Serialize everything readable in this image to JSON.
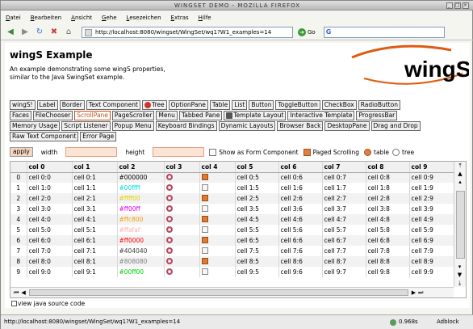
{
  "window": {
    "title": "WINGSET DEMO - MOZILLA FIREFOX"
  },
  "menu": [
    "Datei",
    "Bearbeiten",
    "Ansicht",
    "Gehe",
    "Lesezeichen",
    "Extras",
    "Hilfe"
  ],
  "nav": {
    "url": "http://localhost:8080/wingset/WingSet/wq1?W1_examples=14",
    "go_label": "Go"
  },
  "page": {
    "title": "wingS Example",
    "description": "An example demonstrating some wingS properties, similar to the Java SwingSet example.",
    "logo_text": "wingS"
  },
  "tabs": [
    [
      {
        "label": "wingS!"
      },
      {
        "label": "Label"
      },
      {
        "label": "Border"
      },
      {
        "label": "Text Component"
      },
      {
        "label": "Tree",
        "icon": "tree-icon"
      },
      {
        "label": "OptionPane"
      },
      {
        "label": "Table"
      },
      {
        "label": "List"
      },
      {
        "label": "Button"
      },
      {
        "label": "ToggleButton"
      },
      {
        "label": "CheckBox"
      },
      {
        "label": "RadioButton"
      }
    ],
    [
      {
        "label": "Faces"
      },
      {
        "label": "FileChooser"
      },
      {
        "label": "ScrollPane",
        "selected": true
      },
      {
        "label": "PageScroller"
      },
      {
        "label": "Menu"
      },
      {
        "label": "Tabbed Pane"
      },
      {
        "label": "Template Layout",
        "icon": "template-icon"
      },
      {
        "label": "Interactive Template"
      },
      {
        "label": "ProgressBar"
      }
    ],
    [
      {
        "label": "Memory Usage"
      },
      {
        "label": "Script Listener"
      },
      {
        "label": "Popup Menu"
      },
      {
        "label": "Keyboard Bindings"
      },
      {
        "label": "Dynamic Layouts"
      },
      {
        "label": "Browser Back"
      },
      {
        "label": "DesktopPane"
      },
      {
        "label": "Drag and Drop"
      }
    ],
    [
      {
        "label": "Raw Text Component"
      },
      {
        "label": "Error Page"
      }
    ]
  ],
  "controls": {
    "apply": "apply",
    "width_label": "width",
    "height_label": "height",
    "show_form": "Show as Form Component",
    "paged": "Paged Scrolling",
    "table": "table",
    "tree": "tree"
  },
  "table": {
    "headers": [
      "col 0",
      "col 1",
      "col 2",
      "col 3",
      "col 4",
      "col 5",
      "col 6",
      "col 7",
      "col 8",
      "col 9"
    ],
    "rows": [
      {
        "n": "0",
        "c0": "cell 0:0",
        "c1": "cell 0:1",
        "c2": "#000000",
        "c2color": "#000000",
        "c4": true,
        "c5": "cell 0:5",
        "c6": "cell 0:6",
        "c7": "cell 0:7",
        "c8": "cell 0:8",
        "c9": "cell 0:9"
      },
      {
        "n": "1",
        "c0": "cell 1:0",
        "c1": "cell 1:1",
        "c2": "#00ffff",
        "c2color": "#00e0e0",
        "c4": false,
        "c5": "cell 1:5",
        "c6": "cell 1:6",
        "c7": "cell 1:7",
        "c8": "cell 1:8",
        "c9": "cell 1:9"
      },
      {
        "n": "2",
        "c0": "cell 2:0",
        "c1": "cell 2:1",
        "c2": "#ffff00",
        "c2color": "#e0d000",
        "c4": true,
        "c5": "cell 2:5",
        "c6": "cell 2:6",
        "c7": "cell 2:7",
        "c8": "cell 2:8",
        "c9": "cell 2:9"
      },
      {
        "n": "3",
        "c0": "cell 3:0",
        "c1": "cell 3:1",
        "c2": "#ff00ff",
        "c2color": "#e000e0",
        "c4": false,
        "c5": "cell 3:5",
        "c6": "cell 3:6",
        "c7": "cell 3:7",
        "c8": "cell 3:8",
        "c9": "cell 3:9"
      },
      {
        "n": "4",
        "c0": "cell 4:0",
        "c1": "cell 4:1",
        "c2": "#ffc800",
        "c2color": "#f0a000",
        "c4": true,
        "c5": "cell 4:5",
        "c6": "cell 4:6",
        "c7": "cell 4:7",
        "c8": "cell 4:8",
        "c9": "cell 4:9"
      },
      {
        "n": "5",
        "c0": "cell 5:0",
        "c1": "cell 5:1",
        "c2": "#ffafaf",
        "c2color": "#ffafaf",
        "c4": false,
        "c5": "cell 5:5",
        "c6": "cell 5:6",
        "c7": "cell 5:7",
        "c8": "cell 5:8",
        "c9": "cell 5:9"
      },
      {
        "n": "6",
        "c0": "cell 6:0",
        "c1": "cell 6:1",
        "c2": "#ff0000",
        "c2color": "#ff0000",
        "c4": true,
        "c5": "cell 6:5",
        "c6": "cell 6:6",
        "c7": "cell 6:7",
        "c8": "cell 6:8",
        "c9": "cell 6:9"
      },
      {
        "n": "7",
        "c0": "cell 7:0",
        "c1": "cell 7:1",
        "c2": "#404040",
        "c2color": "#404040",
        "c4": false,
        "c5": "cell 7:5",
        "c6": "cell 7:6",
        "c7": "cell 7:7",
        "c8": "cell 7:8",
        "c9": "cell 7:9"
      },
      {
        "n": "8",
        "c0": "cell 8:0",
        "c1": "cell 8:1",
        "c2": "#808080",
        "c2color": "#808080",
        "c4": true,
        "c5": "cell 8:5",
        "c6": "cell 8:6",
        "c7": "cell 8:7",
        "c8": "cell 8:8",
        "c9": "cell 8:9"
      },
      {
        "n": "9",
        "c0": "cell 9:0",
        "c1": "cell 9:1",
        "c2": "#00ff00",
        "c2color": "#00d000",
        "c4": false,
        "c5": "cell 9:5",
        "c6": "cell 9:6",
        "c7": "cell 9:7",
        "c8": "cell 9:8",
        "c9": "cell 9:9"
      }
    ]
  },
  "source_link": "view java source code",
  "status": {
    "text": "http://localhost:8080/wingset/WingSet/wq1?W1_examples=14",
    "time": "0.968s",
    "adblock": "Adblock"
  }
}
